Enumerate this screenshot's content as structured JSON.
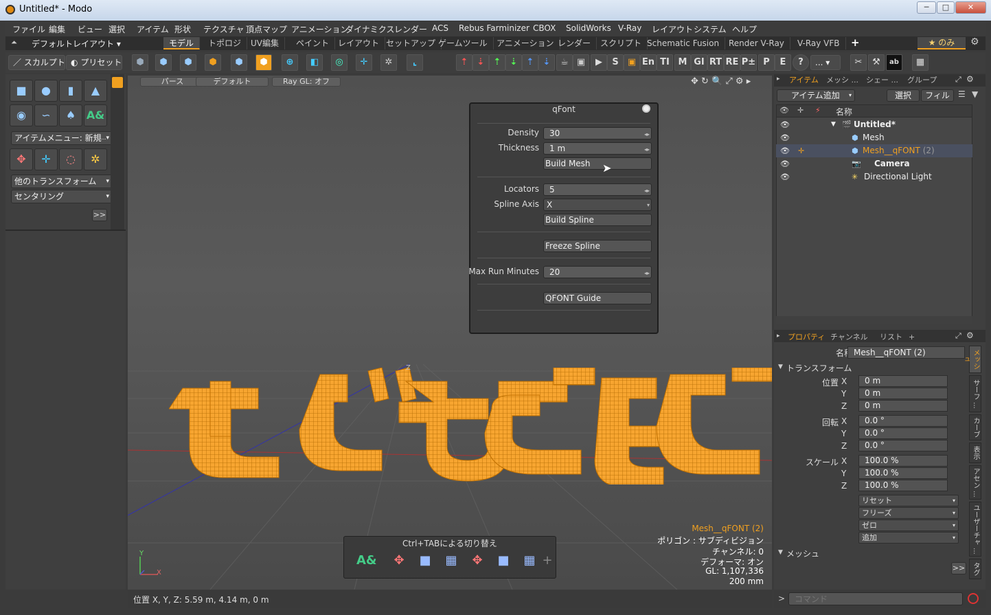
{
  "window": {
    "title": "Untitled* - Modo",
    "minimize": "─",
    "maximize": "□",
    "close": "✕"
  },
  "menu": [
    "ファイル",
    "編集",
    "ビュー",
    "選択",
    "アイテム",
    "形状",
    "テクスチャ",
    "頂点マップ",
    "アニメーション",
    "ダイナミクス",
    "レンダー",
    "ACS",
    "Rebus Farminizer",
    "CBOX",
    "SolidWorks",
    "V-Ray",
    "レイアウト",
    "システム",
    "ヘルプ"
  ],
  "layout_switch": "デフォルトレイアウト",
  "tabs": [
    "モデル",
    "トポロジ",
    "UV編集",
    "ペイント",
    "レイアウト",
    "セットアップ",
    "ゲームツール",
    "アニメーション",
    "レンダー",
    "スクリプト",
    "Schematic Fusion",
    "Render V-Ray",
    "V-Ray VFB"
  ],
  "tab_add": "+",
  "only_label": "★ のみ",
  "toolbar": {
    "sculpt": "スカルプト",
    "preset": "プリセット",
    "labels": [
      "S",
      "En",
      "TI",
      "M",
      "GI",
      "RT",
      "RE",
      "P±",
      "P",
      "E",
      "?",
      "..."
    ]
  },
  "left": {
    "item_menu": "アイテムメニュー: 新規",
    "other_transform": "他のトランスフォーム",
    "centering": "センタリング",
    "more": ">>"
  },
  "viewport": {
    "buttons": [
      "パース",
      "デフォルト",
      "Ray GL: オフ"
    ],
    "info": {
      "item": "Mesh__qFONT (2)",
      "polygon": "ポリゴン : サブディビジョン",
      "channel": "チャンネル: 0",
      "deformer": "デフォーマ: オン",
      "gl": "GL: 1,107,336",
      "scale": "200 mm"
    },
    "tray_title": "Ctrl+TABによる切り替え",
    "axis_y": "Y",
    "axis_x": "X",
    "axis_z": "Z"
  },
  "qfont": {
    "title": "qFont",
    "density_label": "Density",
    "density": "30",
    "thickness_label": "Thickness",
    "thickness": "1 m",
    "build_mesh": "Build Mesh",
    "locators_label": "Locators",
    "locators": "5",
    "spline_axis_label": "Spline Axis",
    "spline_axis": "X",
    "build_spline": "Build Spline",
    "freeze_spline": "Freeze Spline",
    "max_run_label": "Max Run Minutes",
    "max_run": "20",
    "guide": "QFONT Guide"
  },
  "items_panel": {
    "tabs": [
      "アイテム",
      "メッシ ...",
      "シェー ...",
      "グループ"
    ],
    "add_item": "アイテム追加",
    "select": "選択",
    "filter": "フィル ...",
    "name_header": "名称",
    "tree": [
      {
        "name": "Untitled*",
        "bold": true
      },
      {
        "name": "Mesh",
        "bold": false
      },
      {
        "name": "Mesh__qFONT",
        "suffix": " (2)",
        "selected": true
      },
      {
        "name": "Camera",
        "bold": true
      },
      {
        "name": "Directional Light",
        "bold": false
      }
    ]
  },
  "props_panel": {
    "tabs": [
      "プロパティ",
      "チャンネル",
      "リスト",
      "+"
    ],
    "name_label": "名称",
    "name_value": "Mesh__qFONT (2)",
    "transform_header": "トランスフォーム",
    "pos_label": "位置",
    "rot_label": "回転",
    "scale_label": "スケール",
    "axes": [
      "X",
      "Y",
      "Z"
    ],
    "pos": [
      "0 m",
      "0 m",
      "0 m"
    ],
    "rot": [
      "0.0 °",
      "0.0 °",
      "0.0 °"
    ],
    "scale": [
      "100.0 %",
      "100.0 %",
      "100.0 %"
    ],
    "actions": [
      "リセット",
      "フリーズ",
      "ゼロ",
      "追加"
    ],
    "mesh_header": "メッシュ",
    "more": ">>",
    "vtabs": [
      "メッシュ",
      "サーフ ...",
      "カーブ",
      "表示",
      "アセン ...",
      "ユーザーチャ ...",
      "タグ"
    ]
  },
  "status": {
    "position": "位置 X, Y, Z:   5.59 m, 4.14 m, 0 m"
  },
  "command": {
    "prompt": ">",
    "placeholder": "コマンド"
  },
  "colors": {
    "accent": "#f0a020",
    "mesh": "#f7a530",
    "selection": "#4a5060"
  }
}
